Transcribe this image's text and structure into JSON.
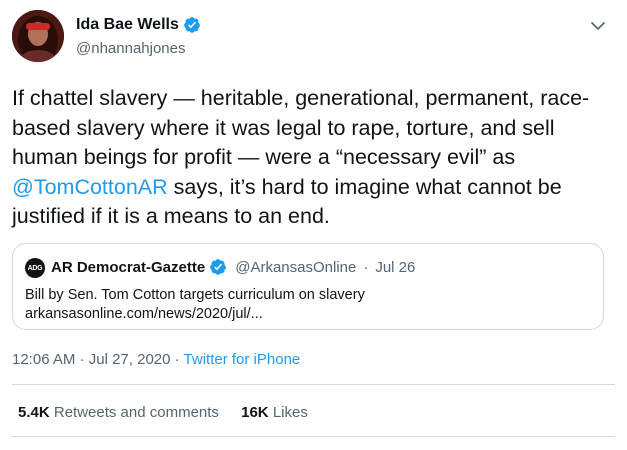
{
  "author": {
    "name": "Ida Bae Wells",
    "handle": "@nhannahjones",
    "verified": true
  },
  "tweet": {
    "text_part1": "If chattel slavery — heritable, generational, permanent, race-based slavery where it was legal to rape, torture, and sell human beings for profit — were a “necessary evil” as ",
    "mention": "@TomCottonAR",
    "text_part2": " says, it’s hard to imagine what cannot be justified if it is a means to an end."
  },
  "quote": {
    "logo_text": "ADG",
    "name": "AR Democrat-Gazette",
    "verified": true,
    "handle": "@ArkansasOnline",
    "separator": "·",
    "date": "Jul 26",
    "text_line1": "Bill by Sen. Tom Cotton targets curriculum on slavery",
    "text_line2": "arkansasonline.com/news/2020/jul/..."
  },
  "meta": {
    "time": "12:06 AM",
    "sep1": "·",
    "date": "Jul 27, 2020",
    "sep2": "·",
    "source": "Twitter for iPhone"
  },
  "stats": {
    "retweets_count": "5.4K",
    "retweets_label": "Retweets and comments",
    "likes_count": "16K",
    "likes_label": "Likes"
  },
  "colors": {
    "accent": "#1d9bf0",
    "text": "#0f1419",
    "muted": "#536471",
    "border": "#cfd9de"
  },
  "icons": {
    "verified": "verified-badge-icon",
    "more": "chevron-down-icon"
  }
}
